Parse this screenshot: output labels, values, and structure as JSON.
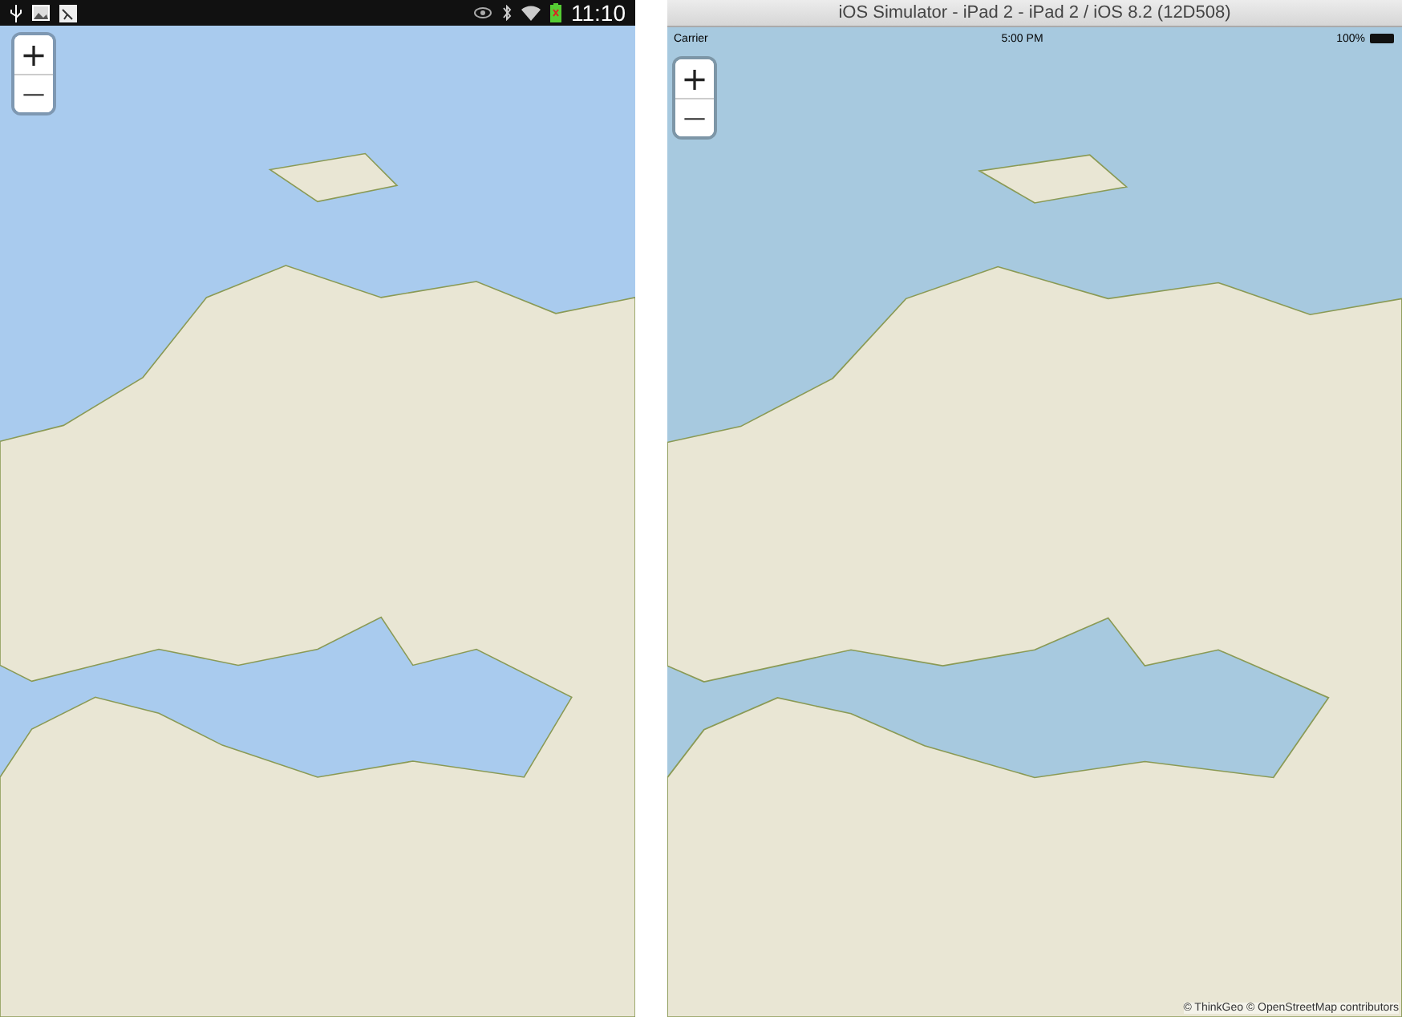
{
  "android": {
    "status_bar": {
      "time": "11:10"
    },
    "zoom": {
      "zoom_in": "+",
      "zoom_out": "—"
    }
  },
  "ios": {
    "window": {
      "title": "iOS Simulator - iPad 2 - iPad 2 / iOS 8.2 (12D508)"
    },
    "status_bar": {
      "carrier": "Carrier",
      "time": "5:00 PM",
      "battery": "100%"
    },
    "zoom": {
      "zoom_in": "+",
      "zoom_out": "—"
    },
    "attribution": "© ThinkGeo © OpenStreetMap contributors"
  }
}
